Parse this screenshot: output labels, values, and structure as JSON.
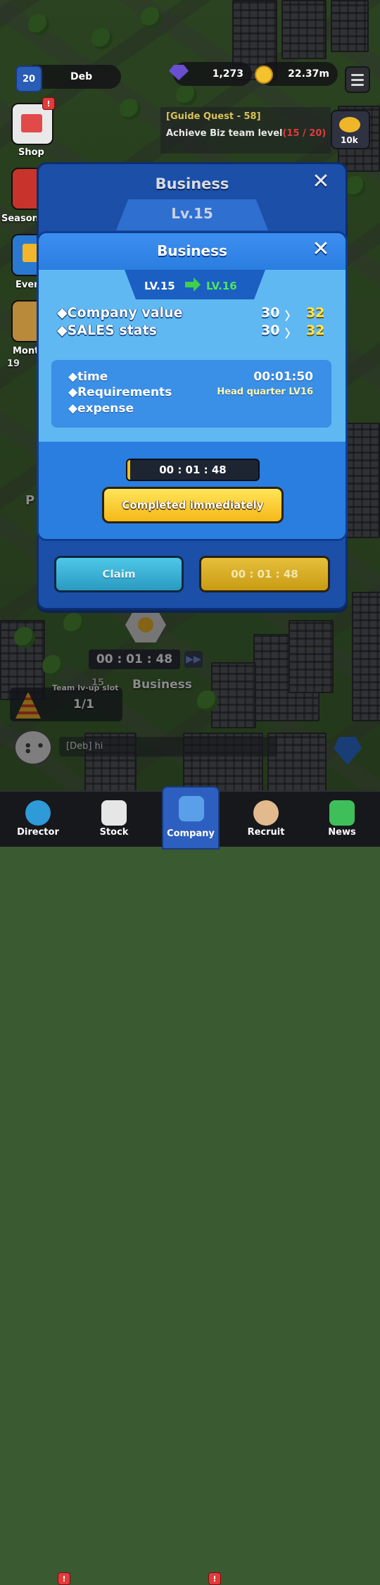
{
  "hud": {
    "level": "20",
    "player_name": "Deb",
    "gems": "1,273",
    "coins": "22.37m"
  },
  "side": {
    "shop_label": "Shop",
    "shop_badge": "!",
    "season_label": "Season",
    "event_label": "Even",
    "monthly_label": "Mont",
    "monthly_count": "19"
  },
  "quest": {
    "title": "[Guide Quest - 58]",
    "text": "Achieve Biz team level",
    "progress": "(15 / 20)",
    "reward": "10k"
  },
  "outer_panel": {
    "title": "Business",
    "level": "Lv.15"
  },
  "upgrade": {
    "title": "Business",
    "from_level": "LV.15",
    "to_level": "LV.16",
    "stats": [
      {
        "label": "◆Company value",
        "current": "30",
        "next": "32"
      },
      {
        "label": "◆SALES stats",
        "current": "30",
        "next": "32"
      }
    ],
    "arrow": "〉",
    "info": {
      "time_label": "◆time",
      "time_value": "00:01:50",
      "req_label": "◆Requirements",
      "req_value": "Head quarter LV16",
      "expense_label": "◆expense"
    },
    "timer": "00 : 01 : 48",
    "complete_button": "Completed immediately"
  },
  "footer_buttons": {
    "claim": "Claim",
    "timer": "00 : 01 : 48"
  },
  "scene": {
    "building_timer": "00 : 01 : 48",
    "building_level": "15",
    "building_name": "Business",
    "team_slot_label": "Team lv-up slot",
    "team_slot_value": "1/1",
    "chat_text": "[Deb] hi",
    "side_p": "P"
  },
  "nav": {
    "items": [
      {
        "label": "Director"
      },
      {
        "label": "Stock"
      },
      {
        "label": "Company"
      },
      {
        "label": "Recruit"
      },
      {
        "label": "News"
      }
    ]
  },
  "colors": {
    "panel_blue": "#1b4fa8",
    "popup_blue": "#2a7ee0",
    "upgrade_green": "#4de65a",
    "value_yellow": "#ffe24a",
    "button_yellow": "#f5b818",
    "claim_cyan": "#2a9ac0"
  }
}
